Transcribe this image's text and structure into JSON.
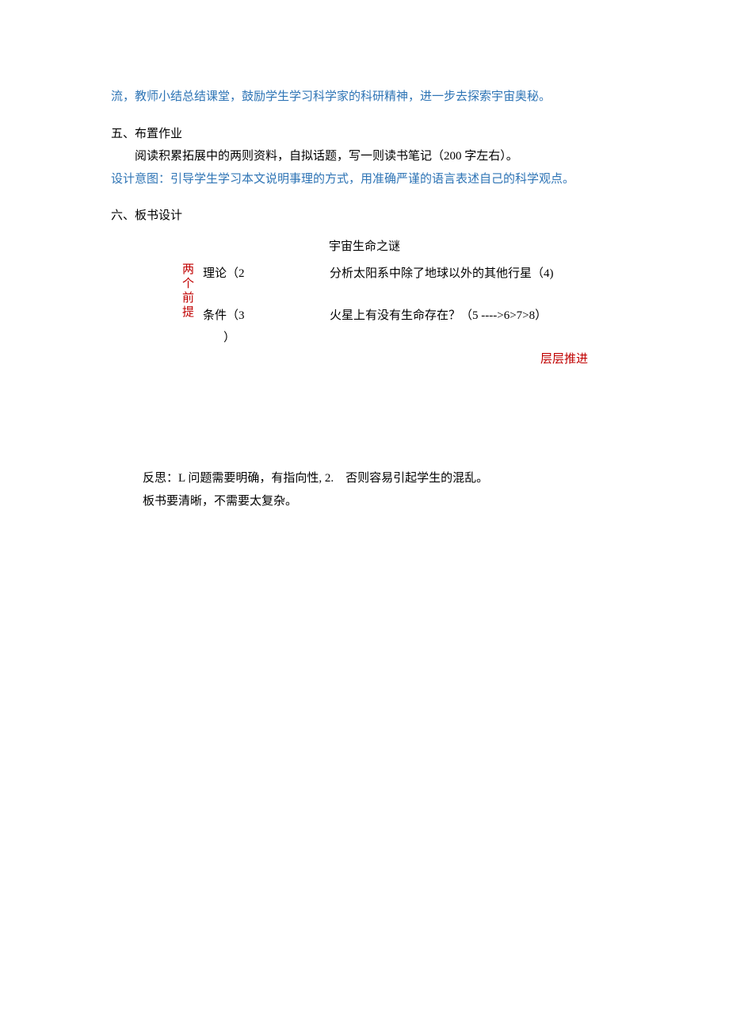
{
  "intro": {
    "line1": "流，教师小结总结课堂，鼓励学生学习科学家的科研精神，进一步去探索宇宙奥秘。"
  },
  "homework": {
    "heading": "五、布置作业",
    "body": "阅读积累拓展中的两则资料，自拟话题，写一则读书笔记（200 字左右）。",
    "intent": "设计意图：引导学生学习本文说明事理的方式，用准确严谨的语言表述自己的科学观点。"
  },
  "board": {
    "heading": "六、板书设计",
    "title": "宇宙生命之谜",
    "premise": "两个前提",
    "row1_left": "理论（2",
    "row1_right": "分析太阳系中除了地球以外的其他行星（4)",
    "row2_left": "条件（3",
    "row2_right": "火星上有没有生命存在？（5 ---->6>7>8）",
    "paren_close": "）",
    "layered": "层层推进"
  },
  "reflection": {
    "line1": "反思：L 问题需要明确，有指向性, 2.　否则容易引起学生的混乱。",
    "line2": "板书要清晰，不需要太复杂。"
  }
}
